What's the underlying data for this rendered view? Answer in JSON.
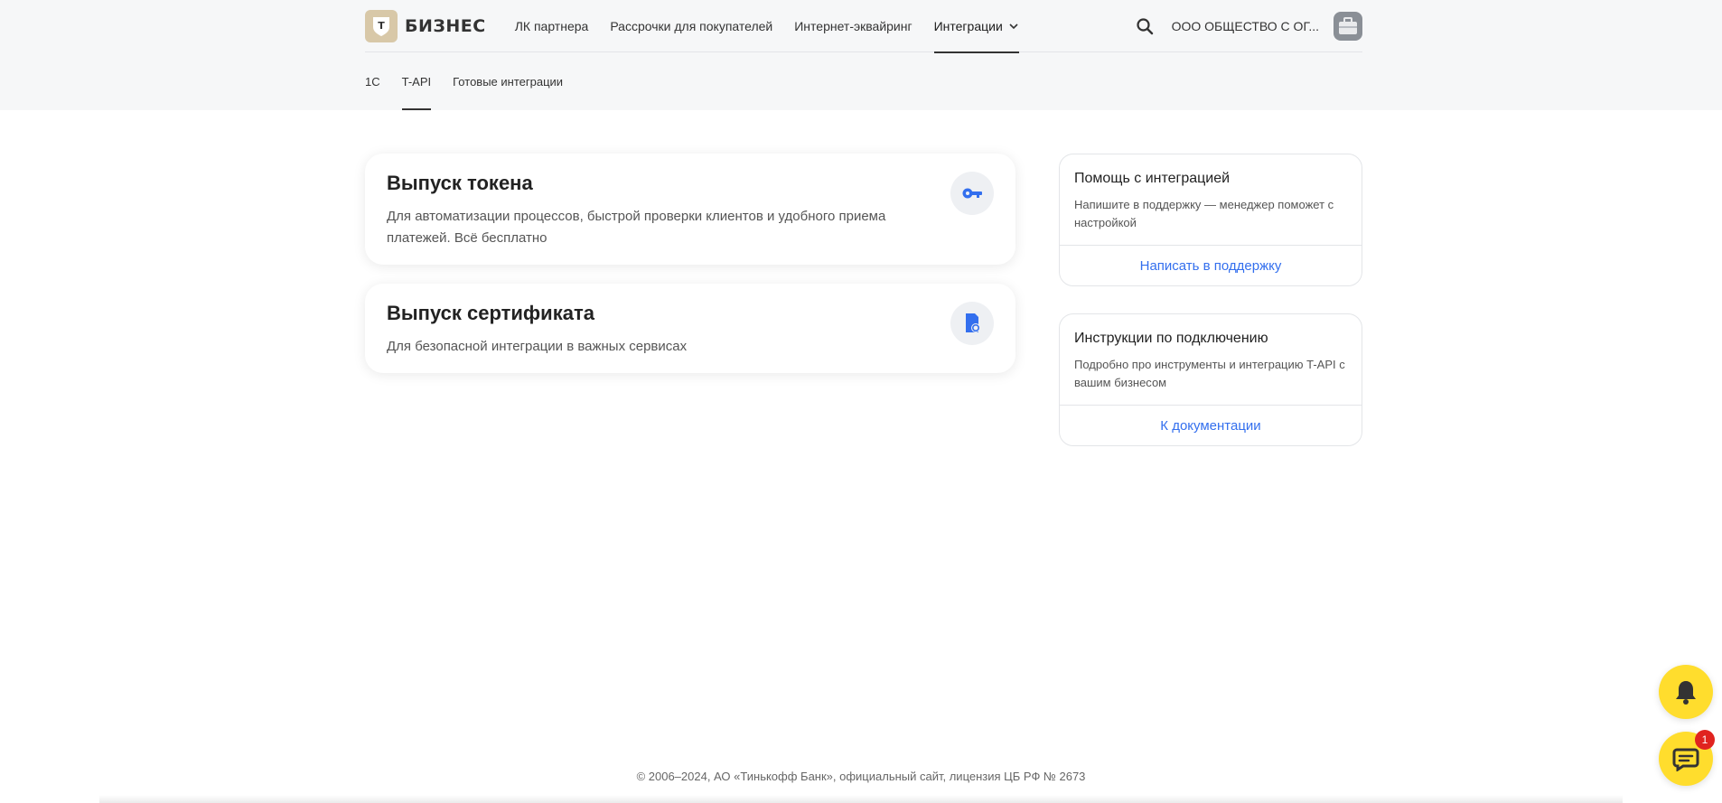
{
  "header": {
    "logo_letter": "Т",
    "logo_text": "БИЗНЕС",
    "nav": [
      {
        "label": "ЛК партнера"
      },
      {
        "label": "Рассрочки для покупателей"
      },
      {
        "label": "Интернет-эквайринг"
      },
      {
        "label": "Интеграции"
      }
    ],
    "company": "ООО ОБЩЕСТВО С ОГ...",
    "search_icon": "search-icon",
    "avatar_icon": "briefcase-icon"
  },
  "subnav": [
    {
      "label": "1С"
    },
    {
      "label": "T-API"
    },
    {
      "label": "Готовые интеграции"
    }
  ],
  "cards": [
    {
      "title": "Выпуск токена",
      "desc": "Для автоматизации процессов, быстрой проверки клиентов и удобного приема платежей. Всё бесплатно",
      "icon": "key-icon"
    },
    {
      "title": "Выпуск сертификата",
      "desc": "Для безопасной интеграции в важных сервисах",
      "icon": "certificate-icon"
    }
  ],
  "side": [
    {
      "title": "Помощь с интеграцией",
      "desc": "Напишите в поддержку — менеджер поможет с настройкой",
      "link": "Написать в поддержку"
    },
    {
      "title": "Инструкции по подключению",
      "desc": "Подробно про инструменты и интеграцию T-API с вашим бизнесом",
      "link": "К документации"
    }
  ],
  "footer": "© 2006–2024, АО «Тинькофф Банк», официальный сайт, лицензия ЦБ РФ № 2673",
  "widgets": {
    "chat_badge": "1",
    "bell_icon": "bell-icon",
    "chat_icon": "chat-icon"
  },
  "colors": {
    "accent": "#ffdd2d",
    "link": "#336fee",
    "header_bg": "#f6f7f8",
    "badge": "#e0231f"
  }
}
